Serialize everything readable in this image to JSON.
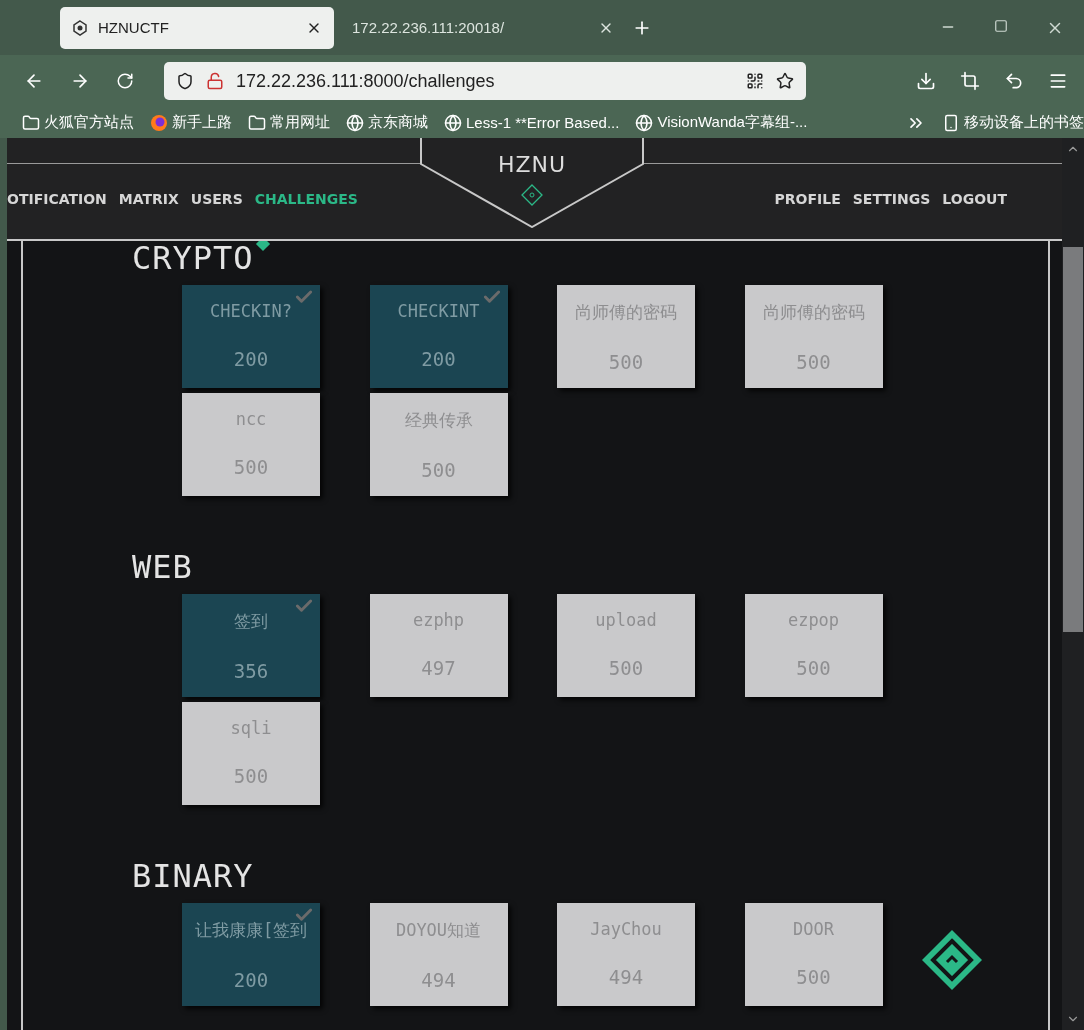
{
  "browser": {
    "tabs": [
      {
        "title": "HZNUCTF",
        "selected": true
      },
      {
        "title": "172.22.236.111:20018/",
        "selected": false
      }
    ],
    "address": "172.22.236.111:8000/challenges",
    "bookmarks": [
      {
        "kind": "folder",
        "label": "火狐官方站点"
      },
      {
        "kind": "firefox",
        "label": "新手上路"
      },
      {
        "kind": "folder",
        "label": "常用网址"
      },
      {
        "kind": "globe",
        "label": "京东商城"
      },
      {
        "kind": "globe",
        "label": "Less-1 **Error Based..."
      },
      {
        "kind": "globe",
        "label": "VisionWanda字幕组-..."
      }
    ],
    "mobile_bookmarks": "移动设备上的书签"
  },
  "nav": {
    "logo": "HZNU",
    "left": [
      {
        "label": "OTIFICATION",
        "selected": false
      },
      {
        "label": "MATRIX",
        "selected": false
      },
      {
        "label": "USERS",
        "selected": false
      },
      {
        "label": "CHALLENGES",
        "selected": true
      }
    ],
    "right": [
      {
        "label": "PROFILE",
        "selected": false
      },
      {
        "label": "SETTINGS",
        "selected": false
      },
      {
        "label": "LOGOUT",
        "selected": false
      }
    ]
  },
  "categories": [
    {
      "title": "CRYPTO",
      "challenges": [
        {
          "name": "CHECKIN?",
          "value": "200",
          "solved": true
        },
        {
          "name": "CHECKINT",
          "value": "200",
          "solved": true
        },
        {
          "name": "尚师傅的密码",
          "value": "500",
          "solved": false
        },
        {
          "name": "尚师傅的密码",
          "value": "500",
          "solved": false
        },
        {
          "name": "ncc",
          "value": "500",
          "solved": false
        },
        {
          "name": "经典传承",
          "value": "500",
          "solved": false
        }
      ]
    },
    {
      "title": "WEB",
      "challenges": [
        {
          "name": "签到",
          "value": "356",
          "solved": true
        },
        {
          "name": "ezphp",
          "value": "497",
          "solved": false
        },
        {
          "name": "upload",
          "value": "500",
          "solved": false
        },
        {
          "name": "ezpop",
          "value": "500",
          "solved": false
        },
        {
          "name": "sqli",
          "value": "500",
          "solved": false
        }
      ]
    },
    {
      "title": "BINARY",
      "challenges": [
        {
          "name": "让我康康[签到",
          "value": "200",
          "solved": true
        },
        {
          "name": "DOYOU知道",
          "value": "494",
          "solved": false
        },
        {
          "name": "JayChou",
          "value": "494",
          "solved": false
        },
        {
          "name": "DOOR",
          "value": "500",
          "solved": false
        }
      ]
    }
  ]
}
